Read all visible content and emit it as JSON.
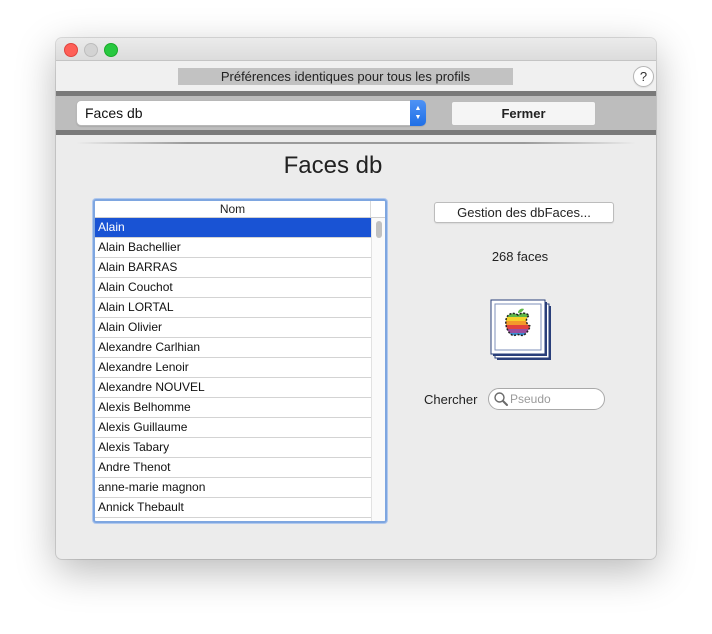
{
  "window": {
    "banner": "Préférences identiques pour tous les profils",
    "help_label": "?"
  },
  "toolbar": {
    "popup_value": "Faces db",
    "close_label": "Fermer"
  },
  "main": {
    "title": "Faces db",
    "list": {
      "column_header": "Nom",
      "selected_index": 0,
      "items": [
        "Alain",
        "Alain Bachellier",
        "Alain BARRAS",
        "Alain Couchot",
        "Alain LORTAL",
        "Alain Olivier",
        "Alexandre Carlhian",
        "Alexandre Lenoir",
        "Alexandre NOUVEL",
        "Alexis Belhomme",
        "Alexis Guillaume",
        "Alexis Tabary",
        "Andre Thenot",
        "anne-marie magnon",
        "Annick Thebault"
      ]
    },
    "manage_button": "Gestion des dbFaces...",
    "faces_count": "268 faces",
    "face_icon": "rainbow-apple-icon",
    "search": {
      "label": "Chercher",
      "placeholder": "Pseudo",
      "value": ""
    }
  },
  "colors": {
    "selection": "#1953d4",
    "focus_ring": "#7ea6e0",
    "popup_arrow": "#2a76ee",
    "close_light": "#fe5f57",
    "zoom_light": "#28c840"
  }
}
